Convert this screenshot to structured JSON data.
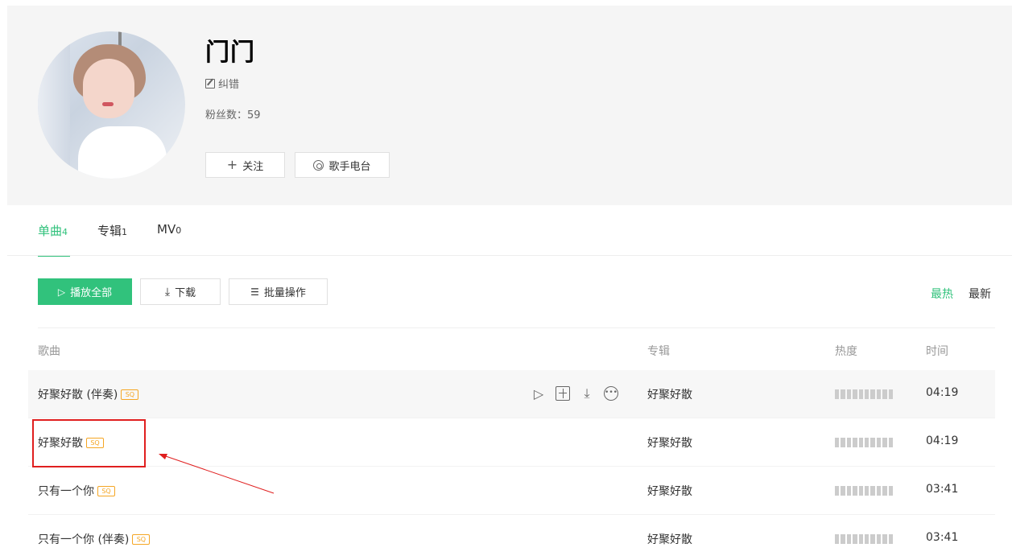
{
  "singer": {
    "name": "门门",
    "correct_label": "纠错",
    "fans_label": "粉丝数：59",
    "follow_label": "关注",
    "radio_label": "歌手电台"
  },
  "tabs": [
    {
      "label": "单曲",
      "count": "4",
      "active": true
    },
    {
      "label": "专辑",
      "count": "1",
      "active": false
    },
    {
      "label": "MV",
      "count": "0",
      "active": false
    }
  ],
  "toolbar": {
    "play_all_label": "播放全部",
    "download_label": "下载",
    "batch_label": "批量操作",
    "sort_hot": "最热",
    "sort_new": "最新"
  },
  "table": {
    "headers": {
      "song": "歌曲",
      "album": "专辑",
      "heat": "热度",
      "time": "时间"
    },
    "quality_badge": "SQ",
    "rows": [
      {
        "title": "好聚好散 (伴奏)",
        "album": "好聚好散",
        "duration": "04:19",
        "hover": true
      },
      {
        "title": "好聚好散",
        "album": "好聚好散",
        "duration": "04:19",
        "hover": false
      },
      {
        "title": "只有一个你",
        "album": "好聚好散",
        "duration": "03:41",
        "hover": false
      },
      {
        "title": "只有一个你 (伴奏)",
        "album": "好聚好散",
        "duration": "03:41",
        "hover": false
      }
    ]
  },
  "colors": {
    "accent": "#31c27c",
    "annotation": "#e01f1f",
    "badge": "#f5a623"
  },
  "icons": {
    "play": "play-icon",
    "add": "add-icon",
    "download": "download-icon",
    "more": "more-icon"
  }
}
